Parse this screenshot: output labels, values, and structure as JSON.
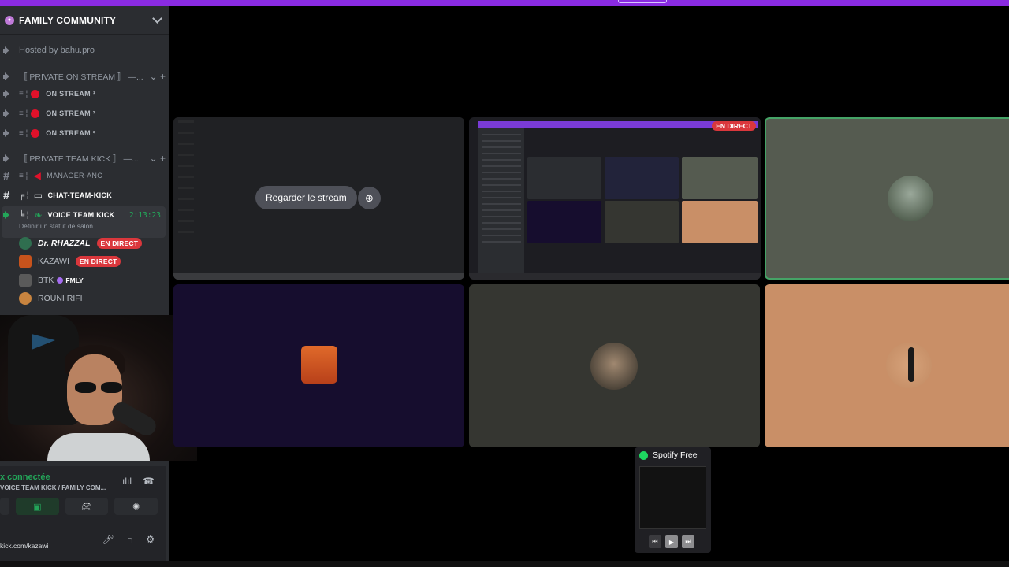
{
  "server": {
    "name": "FAMILY COMMUNITY"
  },
  "channels": {
    "hosted": "Hosted by bahu.pro",
    "cat_stream": "〚 PRIVATE ON STREAM 〛 —...",
    "stream1": "ON STREAM ¹",
    "stream2": "ON STREAM ²",
    "stream3": "ON STREAM ³",
    "cat_team": "〚 PRIVATE TEAM KICK 〛 —...",
    "manager": "MANAGER-ANC",
    "chat_team": "CHAT-TEAM-KICK",
    "voice_team": "VOICE TEAM KICK",
    "timer": "2:13:23",
    "status_hint": "Définir un statut de salon"
  },
  "voice_users": [
    {
      "name": "Dr. RHAZZAL",
      "badge": "EN DIRECT"
    },
    {
      "name": "KAZAWI",
      "badge": "EN DIRECT"
    },
    {
      "name": "BTK",
      "tag": "FMLY"
    },
    {
      "name": "ROUNI RIFI"
    }
  ],
  "voice_panel": {
    "status": "x connectée",
    "channel": "VOICE TEAM KICK / FAMILY COM...",
    "footer": "kick.com/kazawi"
  },
  "stream": {
    "watch_label": "Regarder le stream",
    "live_badge": "EN DIRECT"
  },
  "spotify": {
    "title": "Spotify Free"
  },
  "colors": {
    "accent": "#8a2be2",
    "live": "#da373c",
    "online": "#23a559"
  }
}
